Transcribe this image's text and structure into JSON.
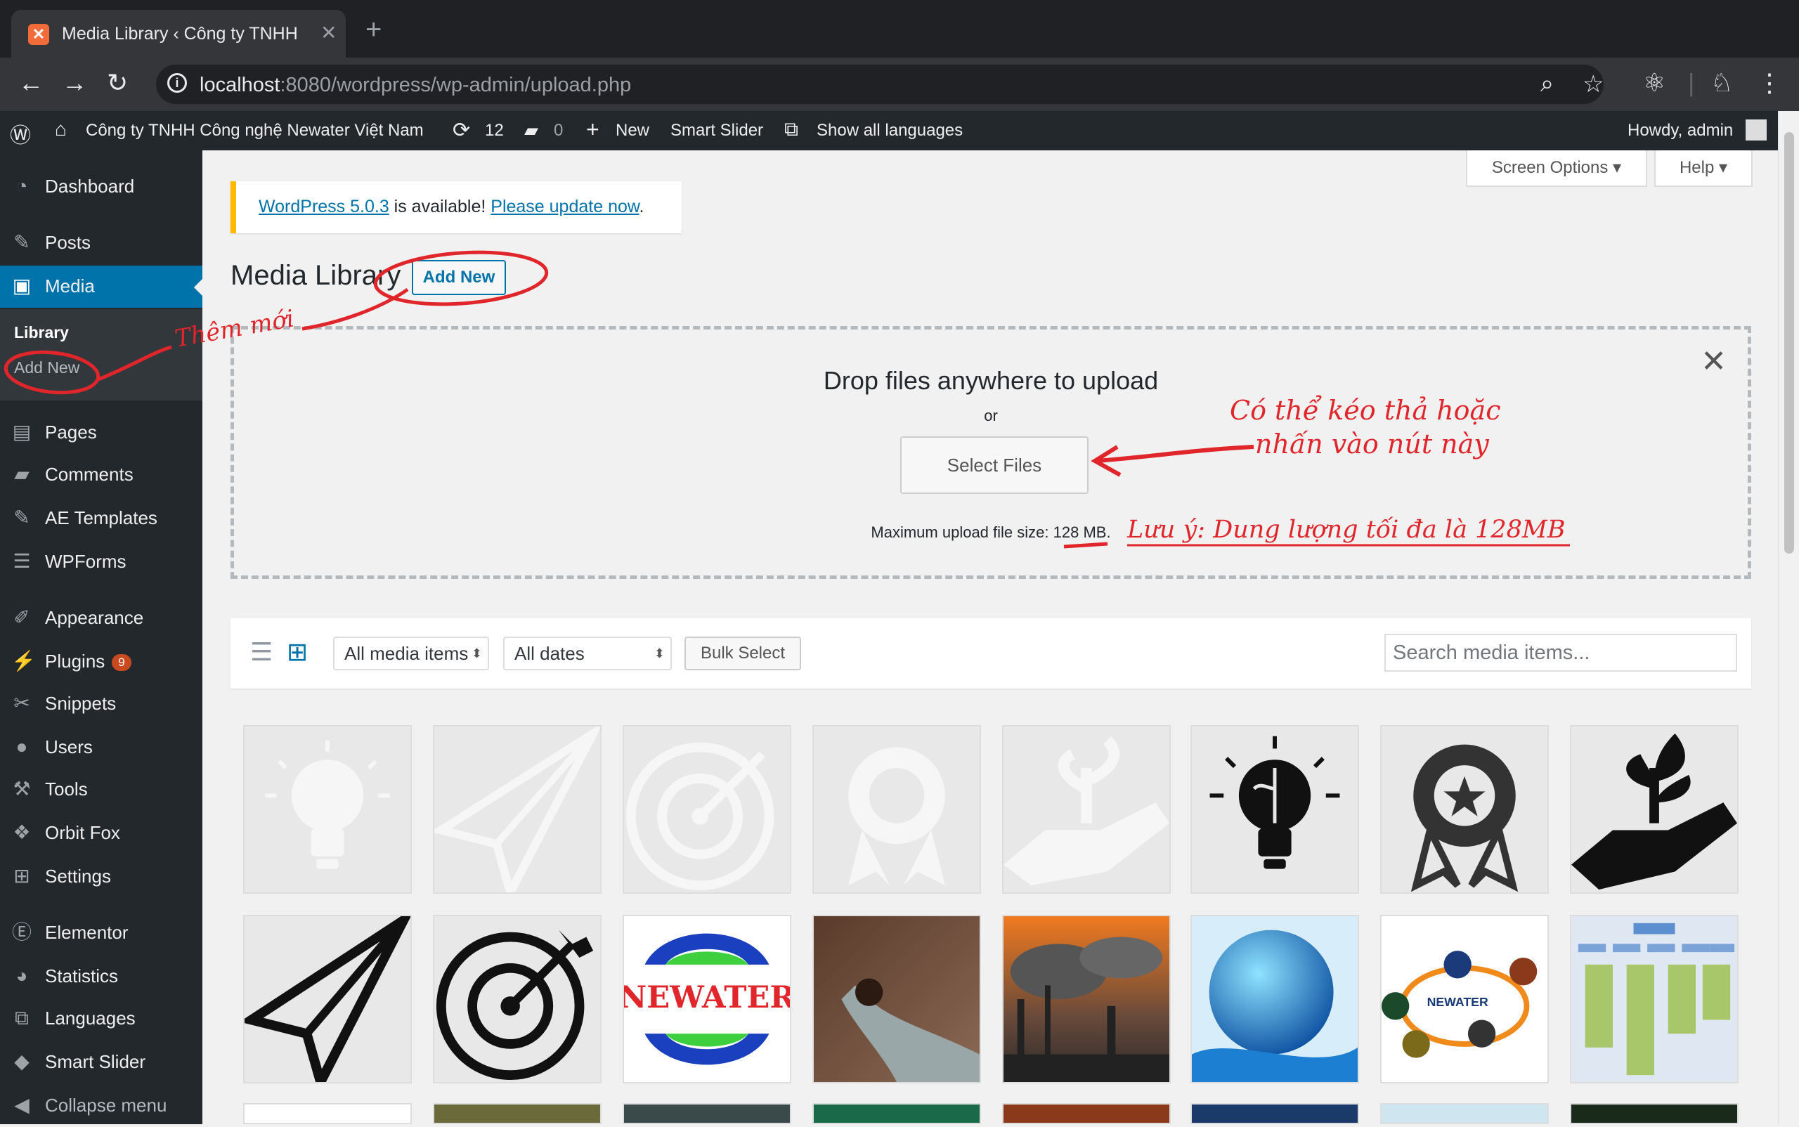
{
  "browser": {
    "tab_title": "Media Library ‹ Công ty TNHH",
    "url_host": "localhost",
    "url_path": ":8080/wordpress/wp-admin/upload.php"
  },
  "adminbar": {
    "site_name": "Công ty TNHH Công nghệ Newater Việt Nam",
    "updates_count": "12",
    "comments_count": "0",
    "new_label": "New",
    "smart_slider_label": "Smart Slider",
    "languages_label": "Show all languages",
    "howdy": "Howdy, admin"
  },
  "sidebar": {
    "items": [
      {
        "label": "Dashboard",
        "icon": "dashboard-icon"
      },
      {
        "label": "Posts",
        "icon": "pin-icon"
      },
      {
        "label": "Media",
        "icon": "media-icon"
      },
      {
        "label": "Pages",
        "icon": "pages-icon"
      },
      {
        "label": "Comments",
        "icon": "comment-icon"
      },
      {
        "label": "AE Templates",
        "icon": "pin-icon"
      },
      {
        "label": "WPForms",
        "icon": "form-icon"
      },
      {
        "label": "Appearance",
        "icon": "brush-icon"
      },
      {
        "label": "Plugins",
        "icon": "plugin-icon",
        "badge": "9"
      },
      {
        "label": "Snippets",
        "icon": "scissors-icon"
      },
      {
        "label": "Users",
        "icon": "user-icon"
      },
      {
        "label": "Tools",
        "icon": "wrench-icon"
      },
      {
        "label": "Orbit Fox",
        "icon": "fox-icon"
      },
      {
        "label": "Settings",
        "icon": "settings-icon"
      },
      {
        "label": "Elementor",
        "icon": "elementor-icon"
      },
      {
        "label": "Statistics",
        "icon": "pie-icon"
      },
      {
        "label": "Languages",
        "icon": "translate-icon"
      },
      {
        "label": "Smart Slider",
        "icon": "slider-icon"
      },
      {
        "label": "Collapse menu",
        "icon": "collapse-icon"
      }
    ],
    "submenu": {
      "library": "Library",
      "add_new": "Add New"
    }
  },
  "header": {
    "screen_options": "Screen Options",
    "help": "Help"
  },
  "notice": {
    "version_link": "WordPress 5.0.3",
    "text": " is available! ",
    "update_link": "Please update now",
    "end": "."
  },
  "page": {
    "title": "Media Library",
    "add_new": "Add New"
  },
  "uploader": {
    "title": "Drop files anywhere to upload",
    "or": "or",
    "select_files": "Select Files",
    "max_size_prefix": "Maximum upload file size: ",
    "max_size_value": "128 MB",
    "max_size_suffix": "."
  },
  "toolbar": {
    "filter_type": "All media items",
    "filter_date": "All dates",
    "bulk_select": "Bulk Select",
    "search_placeholder": "Search media items..."
  },
  "media_items": [
    {
      "name": "brain-bulb-light",
      "kind": "icon"
    },
    {
      "name": "paper-plane-light",
      "kind": "icon"
    },
    {
      "name": "target-light",
      "kind": "icon"
    },
    {
      "name": "award-light",
      "kind": "icon"
    },
    {
      "name": "plant-hand-light",
      "kind": "icon"
    },
    {
      "name": "brain-bulb",
      "kind": "icon"
    },
    {
      "name": "award",
      "kind": "icon"
    },
    {
      "name": "plant-hand",
      "kind": "icon"
    },
    {
      "name": "paper-plane",
      "kind": "icon"
    },
    {
      "name": "target",
      "kind": "icon"
    },
    {
      "name": "newater-logo",
      "kind": "logo",
      "text": "NEWATER"
    },
    {
      "name": "polluted-stream",
      "kind": "photo"
    },
    {
      "name": "factory-smoke",
      "kind": "photo"
    },
    {
      "name": "water-globe",
      "kind": "photo"
    },
    {
      "name": "newater-cycle-diagram",
      "kind": "diagram",
      "text": "NEWATER"
    },
    {
      "name": "org-chart",
      "kind": "diagram"
    }
  ],
  "annotations": {
    "add_new_note": "Thêm mới",
    "drag_note_line1": "Có thể kéo thả hoặc",
    "drag_note_line2": "nhấn vào nút này",
    "size_note": "Lưu ý: Dung lượng tối đa là 128MB"
  },
  "colors": {
    "accent": "#0073aa",
    "annotation": "#e0252b",
    "notice_border": "#ffb900",
    "sidebar_bg": "#23282d"
  }
}
